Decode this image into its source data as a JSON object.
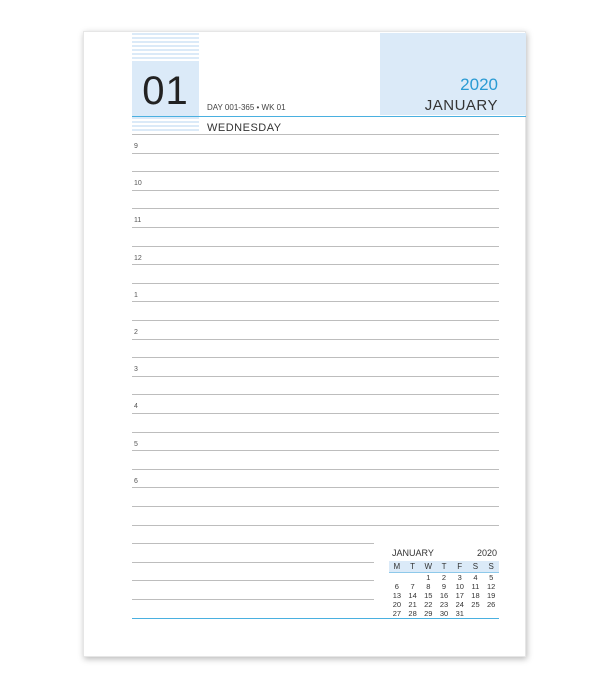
{
  "header": {
    "day_number": "01",
    "day_info": "DAY 001-365 • WK 01",
    "weekday": "WEDNESDAY",
    "year": "2020",
    "month": "JANUARY"
  },
  "hours": [
    "9",
    "10",
    "11",
    "12",
    "1",
    "2",
    "3",
    "4",
    "5",
    "6"
  ],
  "mini_calendar": {
    "month": "JANUARY",
    "year": "2020",
    "weekdays": [
      "M",
      "T",
      "W",
      "T",
      "F",
      "S",
      "S"
    ],
    "weeks": [
      [
        "",
        "",
        "1",
        "2",
        "3",
        "4",
        "5"
      ],
      [
        "6",
        "7",
        "8",
        "9",
        "10",
        "11",
        "12"
      ],
      [
        "13",
        "14",
        "15",
        "16",
        "17",
        "18",
        "19"
      ],
      [
        "20",
        "21",
        "22",
        "23",
        "24",
        "25",
        "26"
      ],
      [
        "27",
        "28",
        "29",
        "30",
        "31",
        "",
        ""
      ]
    ]
  },
  "colors": {
    "accent": "#2a9bd4",
    "panel": "#dbeaf8",
    "rule": "#4ab0e0"
  }
}
